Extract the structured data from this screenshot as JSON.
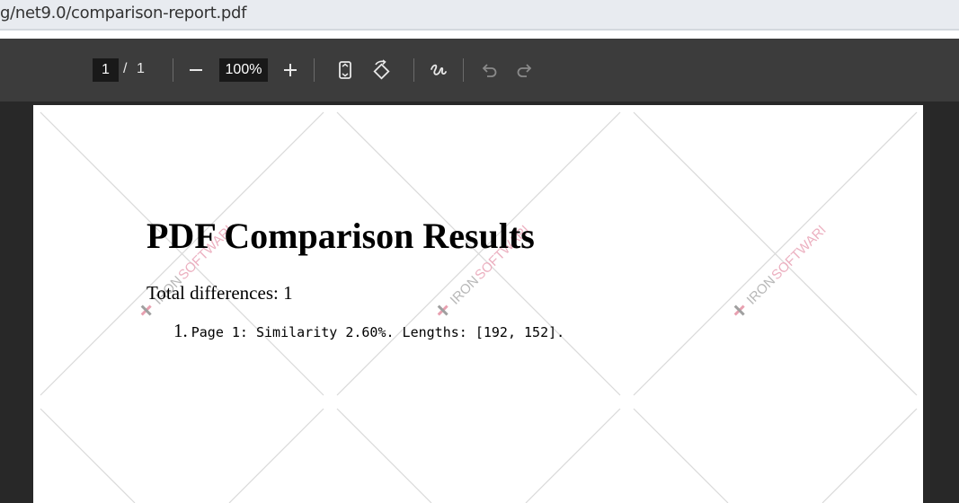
{
  "browser": {
    "url": "g/net9.0/comparison-report.pdf"
  },
  "toolbar": {
    "current_page": "1",
    "page_separator": "/",
    "total_pages": "1",
    "zoom": "100%"
  },
  "document": {
    "title": "PDF Comparison Results",
    "total_differences": "Total differences: 1",
    "items": [
      {
        "number": "1.",
        "text": "Page 1: Similarity 2.60%. Lengths: [192, 152]."
      }
    ],
    "watermark": "IRONSOFTWARE"
  },
  "colors": {
    "toolbar_bg": "#3c3c3c",
    "viewer_bg": "#282828",
    "input_bg": "#191919",
    "watermark_pink": "#e8a0b0",
    "watermark_gray": "#a0a0a0"
  }
}
